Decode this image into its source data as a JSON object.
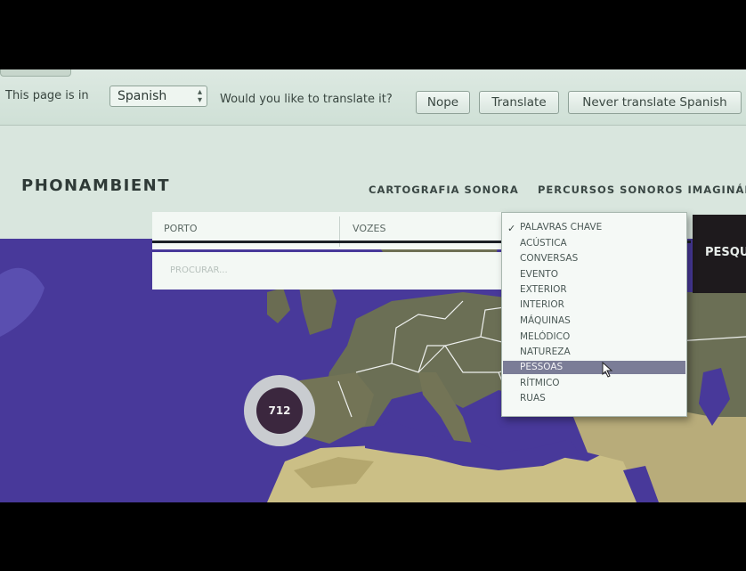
{
  "translate_bar": {
    "prefix": "This page is in",
    "language": "Spanish",
    "question": "Would you like to translate it?",
    "nope": "Nope",
    "translate": "Translate",
    "never": "Never translate Spanish"
  },
  "site": {
    "logo": "PHONAMBIENT",
    "nav": [
      "CARTOGRAFIA SONORA",
      "PERCURSOS SONOROS IMAGINÁR"
    ]
  },
  "filters": {
    "city": "PORTO",
    "category": "VOZES",
    "search_placeholder": "PROCURAR...",
    "search_button": "PESQU"
  },
  "dropdown": {
    "selected": "PALAVRAS CHAVE",
    "options": [
      "PALAVRAS CHAVE",
      "ACÚSTICA",
      "CONVERSAS",
      "EVENTO",
      "EXTERIOR",
      "INTERIOR",
      "MÁQUINAS",
      "MELÓDICO",
      "NATUREZA",
      "PESSOAS",
      "RÍTMICO",
      "RUAS"
    ],
    "highlighted": "PESSOAS"
  },
  "map": {
    "cluster_count": "712",
    "colors": {
      "ocean": "#4a3d9a",
      "land": "#6b6f55",
      "desert": "#c9c08a",
      "border": "#f0f0f0"
    }
  }
}
